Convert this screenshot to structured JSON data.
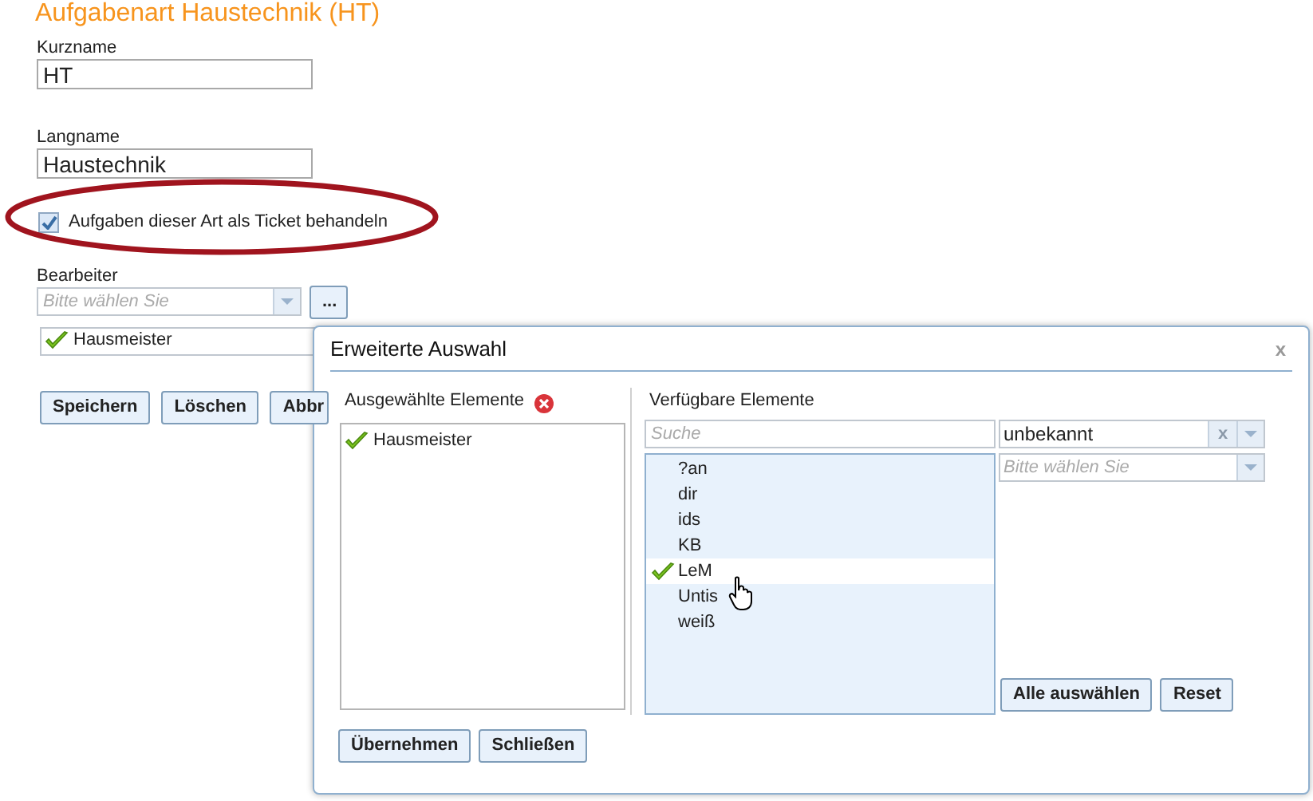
{
  "title": "Aufgabenart Haustechnik (HT)",
  "kurzname": {
    "label": "Kurzname",
    "value": "HT"
  },
  "langname": {
    "label": "Langname",
    "value": "Haustechnik"
  },
  "ticket": {
    "label": "Aufgaben dieser Art als Ticket behandeln",
    "checked": true
  },
  "bearbeiter": {
    "label": "Bearbeiter",
    "placeholder": "Bitte wählen Sie",
    "more": "...",
    "items": [
      {
        "label": "Hausmeister"
      }
    ]
  },
  "buttons": [
    "Speichern",
    "Löschen",
    "Abbr"
  ],
  "dialog": {
    "title": "Erweiterte Auswahl",
    "close": "x",
    "selected_panel": {
      "title": "Ausgewählte Elemente",
      "items": [
        {
          "label": "Hausmeister"
        }
      ]
    },
    "available_panel": {
      "title": "Verfügbare Elemente",
      "search_placeholder": "Suche",
      "items": [
        {
          "label": "?an",
          "selected": false
        },
        {
          "label": "dir",
          "selected": false
        },
        {
          "label": "ids",
          "selected": false
        },
        {
          "label": "KB",
          "selected": false
        },
        {
          "label": "LeM",
          "selected": true
        },
        {
          "label": "Untis",
          "selected": false
        },
        {
          "label": "weiß",
          "selected": false
        }
      ],
      "filter": {
        "value": "unbekannt",
        "clear": "x"
      },
      "filter2": {
        "placeholder": "Bitte wählen Sie"
      },
      "buttons": [
        "Alle auswählen",
        "Reset"
      ]
    },
    "footer_buttons": [
      "Übernehmen",
      "Schließen"
    ]
  }
}
